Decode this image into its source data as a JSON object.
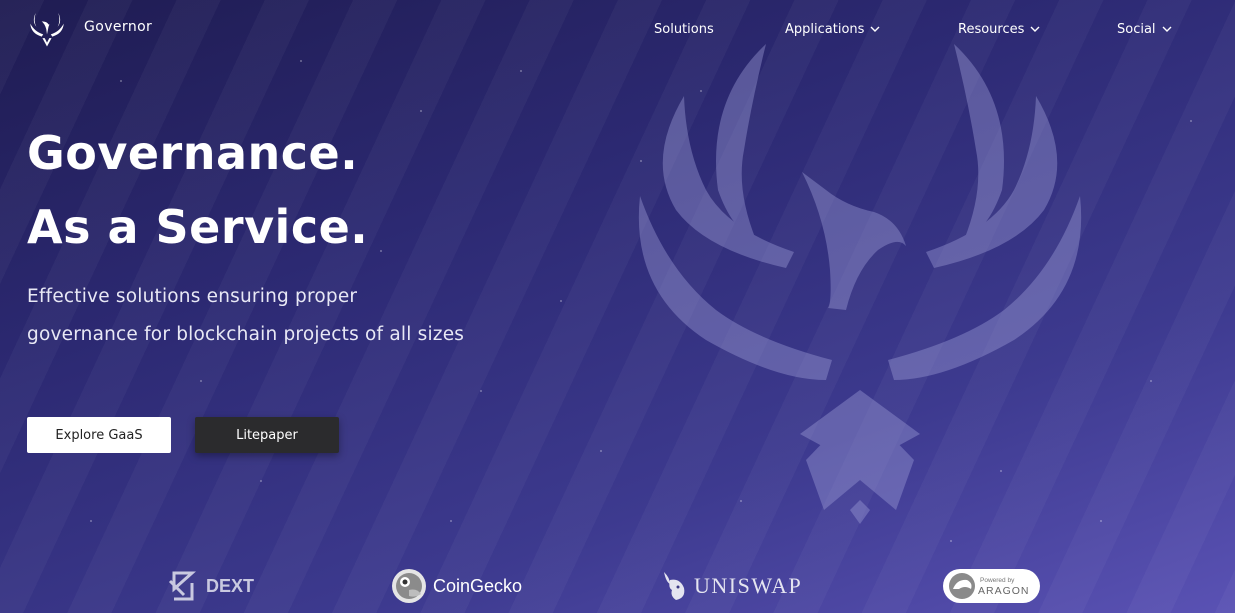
{
  "header": {
    "brand": "Governor",
    "nav": [
      {
        "label": "Solutions",
        "has_dropdown": false
      },
      {
        "label": "Applications",
        "has_dropdown": true
      },
      {
        "label": "Resources",
        "has_dropdown": true
      },
      {
        "label": "Social",
        "has_dropdown": true
      }
    ]
  },
  "hero": {
    "title_line1": "Governance.",
    "title_line2": "As a Service.",
    "subtitle_line1": "Effective solutions ensuring proper",
    "subtitle_line2": "governance for blockchain projects of all sizes",
    "primary_button": "Explore GaaS",
    "secondary_button": "Litepaper"
  },
  "partners": {
    "dext": "DEXT",
    "coingecko": "CoinGecko",
    "uniswap": "UNISWAP",
    "aragon_small": "Powered by",
    "aragon_big": "ARAGON"
  },
  "icons": {
    "logo": "phoenix-logo-icon",
    "chevron": "chevron-down-icon"
  },
  "colors": {
    "background_top": "#1f1c52",
    "background_bottom": "#5a52b4",
    "button_primary_bg": "#ffffff",
    "button_secondary_bg": "#2b2b2d"
  }
}
